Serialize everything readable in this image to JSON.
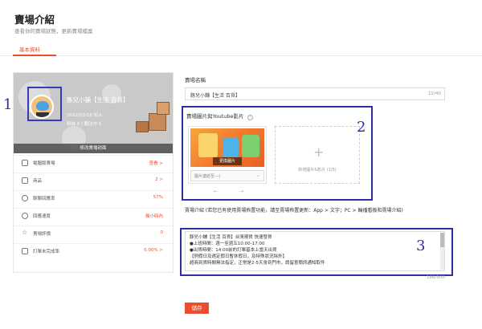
{
  "header": {
    "title": "賣場介紹",
    "subtitle": "查看你的賣場狀態，更新賣場檔案",
    "tab_label": "基本資料"
  },
  "shop_card": {
    "name": "豚兒小舖【生活 百貨】",
    "joined": "2022/03/18 加入",
    "follow_stats": "粉絲 0 | 關注中 1",
    "edit_cover_label": "修改賣場封面",
    "annotation_number": "1",
    "stats": [
      {
        "label": "電腦版賣場",
        "value": "查看 >",
        "icon": "desktop-icon"
      },
      {
        "label": "商品",
        "value": "2 >",
        "icon": "product-icon"
      },
      {
        "label": "聊聊回應率",
        "value": "57%",
        "icon": "chat-icon"
      },
      {
        "label": "回應速度",
        "value": "幾小時內",
        "icon": "clock-icon"
      },
      {
        "label": "賣場評價",
        "value": "0",
        "icon": "star-icon"
      },
      {
        "label": "訂單未完成率",
        "value": "0.00% >",
        "icon": "order-icon"
      }
    ]
  },
  "shop_name_field": {
    "label": "賣場名稱",
    "value": "豚兒小舖【生活 百貨】",
    "counter": "12/40"
  },
  "media": {
    "label": "賣場圖片與Youtube影片",
    "help_icon": "help-icon",
    "change_image_label": "更換圖片",
    "link_select_placeholder": "圖片連結至---(",
    "add_label": "新增圖片&影片 (1/5)",
    "annotation_number": "2"
  },
  "description": {
    "label": "賣場介紹 (若您已有使用賣場佈置功能，請至賣場佈置更新：App > 文字；PC > 輪播看板和賣場介紹)",
    "lines": [
      "豚兒小舖【生活 百貨】台灣現貨 快速發貨",
      "●上班時間：週一至週五10:00-17:00",
      "●出貨時間：14:00前的訂單基本上當天出貨",
      "【例假日及遇定假日暫休假日，及特殊狀況除外】",
      "超商到貨時間無法指定，正常是2-5天會到門市，請留意簡訊通知取件"
    ],
    "counter": "186/500",
    "annotation_number": "3"
  },
  "save_label": "儲存",
  "colors": {
    "accent": "#ee4d2d",
    "annotation": "#2e2ea0"
  }
}
